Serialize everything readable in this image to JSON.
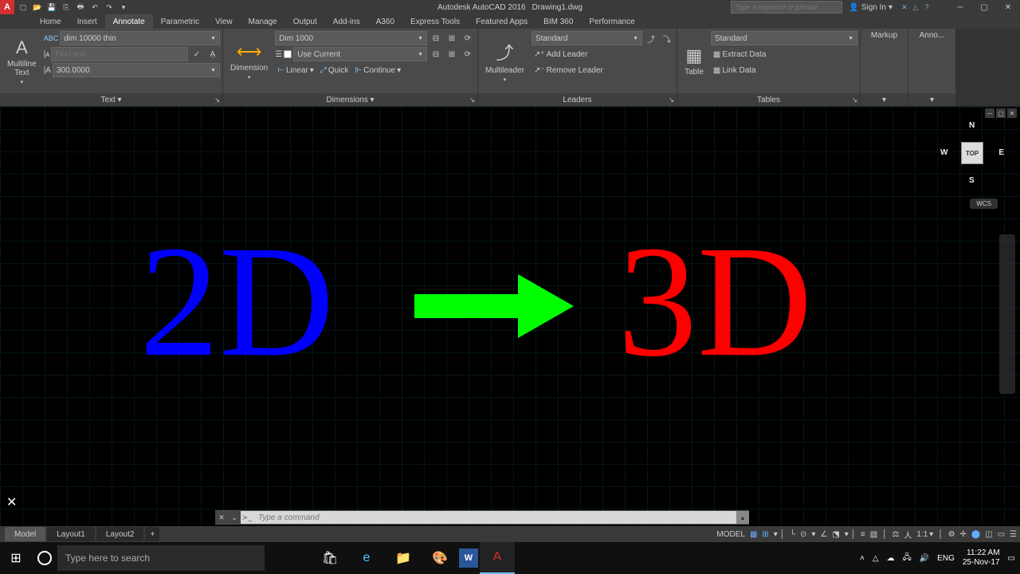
{
  "title": {
    "app": "Autodesk AutoCAD 2016",
    "doc": "Drawing1.dwg"
  },
  "search_placeholder": "Type a keyword or phrase",
  "signin": "Sign In",
  "tabs": [
    "Home",
    "Insert",
    "Annotate",
    "Parametric",
    "View",
    "Manage",
    "Output",
    "Add-ins",
    "A360",
    "Express Tools",
    "Featured Apps",
    "BIM 360",
    "Performance"
  ],
  "active_tab": "Annotate",
  "ribbon": {
    "text": {
      "big": "Multiline\nText",
      "style": "dim 10000 thin",
      "find_placeholder": "Find text",
      "height": "300.0000",
      "title": "Text ▾"
    },
    "dim": {
      "big": "Dimension",
      "style": "Dim 1000",
      "use_current": "Use Current",
      "linear": "Linear",
      "quick": "Quick",
      "continue": "Continue",
      "title": "Dimensions ▾"
    },
    "leader": {
      "big": "Multileader",
      "style": "Standard",
      "add": "Add Leader",
      "remove": "Remove Leader",
      "title": "Leaders"
    },
    "table": {
      "big": "Table",
      "style": "Standard",
      "extract": "Extract Data",
      "link": "Link Data",
      "title": "Tables"
    },
    "markup": "Markup",
    "anno": "Anno..."
  },
  "viewcube": {
    "face": "TOP",
    "n": "N",
    "s": "S",
    "e": "E",
    "w": "W",
    "wcs": "WCS"
  },
  "canvas": {
    "text_left": "2D",
    "text_right": "3D"
  },
  "cmd_placeholder": "Type a command",
  "bottom_tabs": [
    "Model",
    "Layout1",
    "Layout2"
  ],
  "status": {
    "model": "MODEL",
    "scale": "1:1"
  },
  "taskbar": {
    "search_placeholder": "Type here to search",
    "lang": "ENG",
    "time": "11:22 AM",
    "date": "25-Nov-17"
  }
}
